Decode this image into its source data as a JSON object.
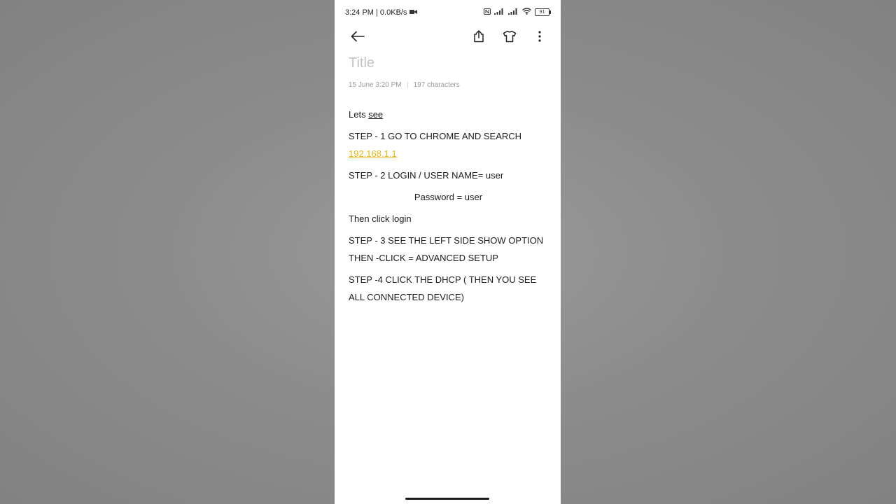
{
  "status_bar": {
    "time_speed": "3:24 PM | 0.0KB/s",
    "battery_level": "91"
  },
  "toolbar": {
    "icons": [
      "back-arrow-icon",
      "share-icon",
      "theme-shirt-icon",
      "more-vertical-icon"
    ]
  },
  "note": {
    "title_placeholder": "Title",
    "date": "15 June  3:20 PM",
    "char_count": "197 characters",
    "lines": {
      "l1_a": "Lets ",
      "l1_b": "see",
      "l2": "STEP - 1 GO TO CHROME AND SEARCH",
      "l2_link": "192.168.1.1",
      "l3": "STEP - 2 LOGIN / USER NAME= user",
      "l4": "Password =  user",
      "l5": "Then click login",
      "l6": "STEP - 3 SEE THE LEFT SIDE SHOW OPTION THEN -CLICK = ADVANCED SETUP",
      "l7": "STEP -4 CLICK THE DHCP ( THEN YOU SEE ALL CONNECTED DEVICE)"
    }
  },
  "colors": {
    "link": "#e8b717",
    "backdrop": "#8a8a8a",
    "page": "#ffffff"
  }
}
